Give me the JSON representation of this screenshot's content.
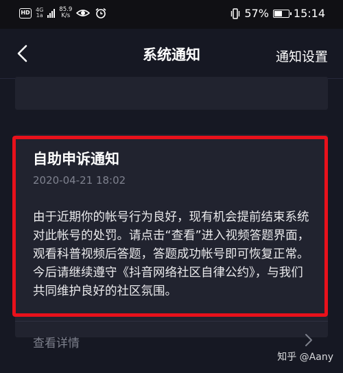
{
  "status_bar": {
    "hd": "HD",
    "network_type": "4G",
    "network_sub": "1a",
    "speed_value": "85.9",
    "speed_unit": "K/s",
    "battery_percent": "57%",
    "battery_level": 0.57,
    "time": "15:14"
  },
  "header": {
    "title": "系统通知",
    "settings_label": "通知设置"
  },
  "notice": {
    "title": "自助申诉通知",
    "date": "2020-04-21 18:02",
    "body": "由于近期你的帐号行为良好，现有机会提前结束系统对此帐号的处罚。请点击“查看”进入视频答题界面，观看科普视频后答题，答题成功帐号即可恢复正常。今后请继续遵守《抖音网络社区自律公约》，与我们共同维护良好的社区氛围。",
    "details_label": "查看详情"
  },
  "watermark": "知乎 @Aany",
  "colors": {
    "background": "#161823",
    "card": "#21232f",
    "highlight_frame": "#e8111b",
    "muted_text": "#7f828f"
  }
}
